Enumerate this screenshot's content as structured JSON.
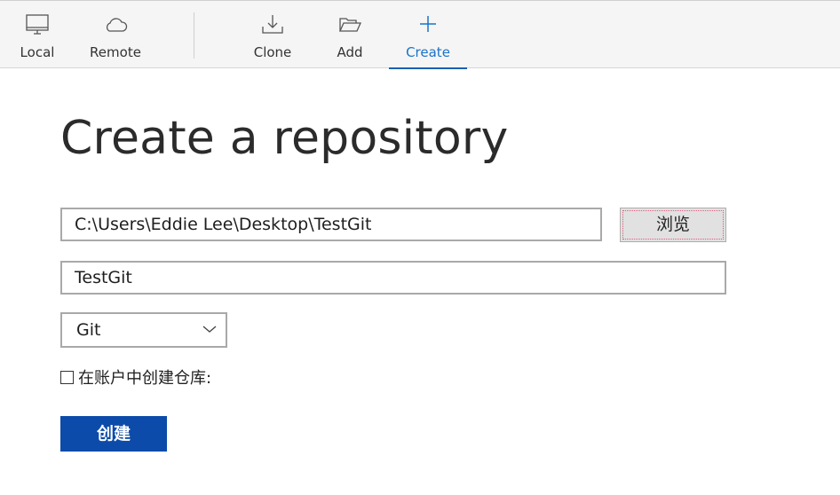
{
  "toolbar": {
    "items": [
      {
        "label": "Local",
        "icon": "monitor-icon"
      },
      {
        "label": "Remote",
        "icon": "cloud-icon"
      },
      {
        "label": "Clone",
        "icon": "download-icon"
      },
      {
        "label": "Add",
        "icon": "folder-open-icon"
      },
      {
        "label": "Create",
        "icon": "plus-icon",
        "active": true
      }
    ],
    "accent_color": "#1a73c8"
  },
  "page": {
    "title": "Create a repository"
  },
  "form": {
    "path_value": "C:\\Users\\Eddie Lee\\Desktop\\TestGit",
    "browse_label": "浏览",
    "name_value": "TestGit",
    "vcs_selected": "Git",
    "account_checkbox_label": "在账户中创建仓库:",
    "account_checkbox_checked": false,
    "create_label": "创建",
    "create_button_color": "#0d4baa"
  }
}
